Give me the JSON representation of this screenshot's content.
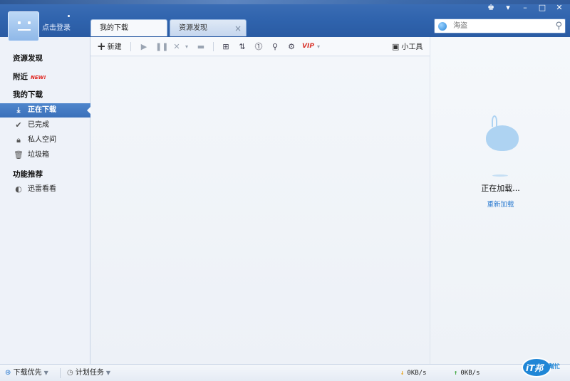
{
  "user": {
    "login_label": "点击登录"
  },
  "tabs": [
    {
      "label": "我的下载",
      "active": true
    },
    {
      "label": "资源发现",
      "active": false
    }
  ],
  "window_controls": [
    "skin-icon",
    "menu-icon",
    "minimize-icon",
    "maximize-icon",
    "close-icon"
  ],
  "search": {
    "placeholder": "海盗",
    "icon": "search-icon"
  },
  "sidebar": {
    "resources": "资源发现",
    "nearby": "附近",
    "nearby_badge": "NEW!",
    "my_downloads": "我的下载",
    "items": [
      {
        "label": "正在下载",
        "icon": "download-icon",
        "active": true
      },
      {
        "label": "已完成",
        "icon": "check-icon",
        "active": false
      },
      {
        "label": "私人空间",
        "icon": "lock-icon",
        "active": false
      },
      {
        "label": "垃圾箱",
        "icon": "trash-icon",
        "active": false
      }
    ],
    "recommend": "功能推荐",
    "recommend_items": [
      {
        "label": "迅雷看看",
        "icon": "kankan-icon"
      }
    ]
  },
  "toolbar": {
    "new_label": "新建",
    "vip_label": "VIP",
    "tools_label": "小工具"
  },
  "right_panel": {
    "loading_text": "正在加载...",
    "reload_link": "重新加载"
  },
  "statusbar": {
    "priority_label": "下载优先",
    "schedule_label": "计划任务",
    "download_speed": "0KB/s",
    "upload_speed": "0KB/s",
    "watermark_main": "iT邦",
    "watermark_sub": "幫忙"
  },
  "colors": {
    "header_blue": "#2f63ad",
    "active_item": "#3a70ba",
    "link_blue": "#2a7ad0",
    "vip_red": "#d9342b"
  }
}
